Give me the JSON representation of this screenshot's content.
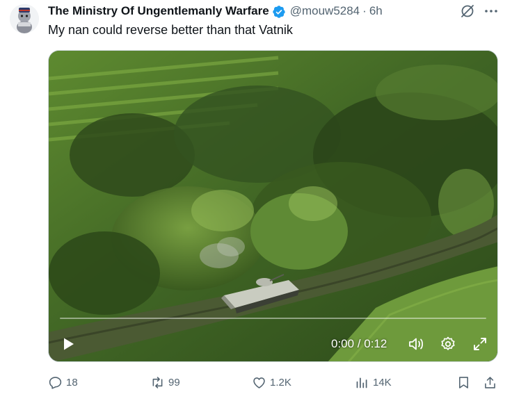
{
  "tweet": {
    "display_name": "The Ministry Of Ungentlemanly Warfare",
    "handle": "@mouw5284",
    "separator": "·",
    "time": "6h",
    "text": "My nan could reverse better than that Vatnik"
  },
  "video": {
    "time_readout": "0:00 / 0:12",
    "progress": 0.0
  },
  "actions": {
    "replies": "18",
    "reposts": "99",
    "likes": "1.2K",
    "views": "14K"
  },
  "colors": {
    "verified": "#1d9bf0",
    "text_primary": "#0f1419",
    "text_secondary": "#536471"
  },
  "icons": {
    "verified": "verified-badge-icon",
    "grok": "grok-icon",
    "more": "more-icon",
    "play": "play-icon",
    "volume": "volume-icon",
    "settings": "settings-icon",
    "fullscreen": "fullscreen-icon",
    "reply": "reply-icon",
    "repost": "repost-icon",
    "like": "like-icon",
    "views": "views-icon",
    "bookmark": "bookmark-icon",
    "share": "share-icon"
  }
}
